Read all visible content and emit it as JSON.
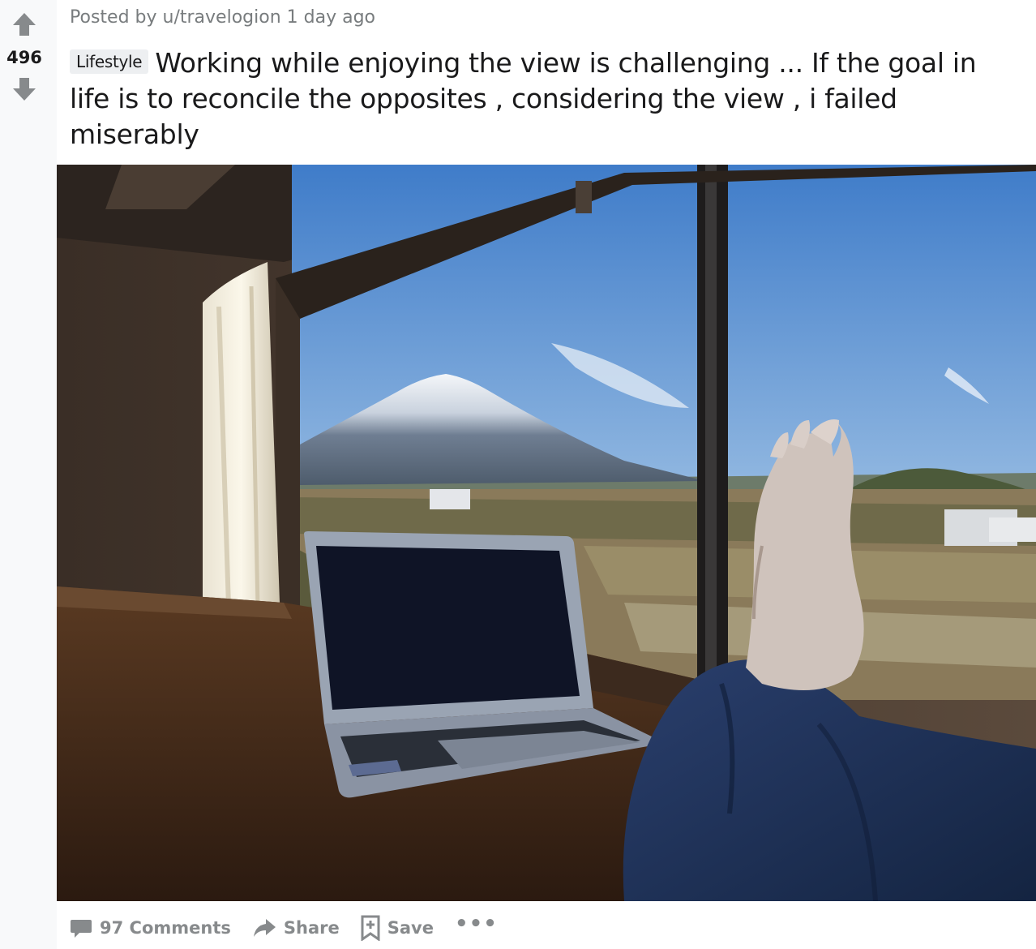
{
  "vote": {
    "score": "496",
    "up_icon": "arrow-up-icon",
    "down_icon": "arrow-down-icon"
  },
  "post": {
    "posted_by_prefix": "Posted by ",
    "author": "u/travelogion",
    "age": "1 day ago",
    "flair": "Lifestyle",
    "title": "Working while enjoying the view is challenging ... If the goal in life is to reconcile the opposites , considering the view , i failed miserably"
  },
  "image": {
    "icon": "photo-laptop-mount-fuji-view"
  },
  "actions": {
    "comments_label": "97 Comments",
    "share_label": "Share",
    "save_label": "Save",
    "more_label": "•••"
  },
  "colors": {
    "meta_text": "#787c7e",
    "action_text": "#878a8c",
    "vote_arrow": "#878a8c",
    "flair_bg": "#edeff1"
  }
}
